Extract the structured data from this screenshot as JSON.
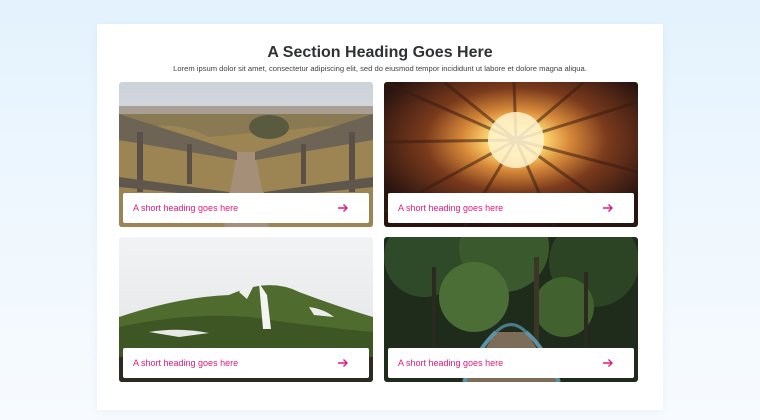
{
  "section": {
    "heading": "A Section Heading Goes Here",
    "subheading": "Lorem ipsum dolor sit amet, consectetur adipiscing elit, sed do eiusmod tempor incididunt ut labore et dolore magna aliqua."
  },
  "cards": [
    {
      "title": "A short heading goes here",
      "icon": "arrow-right-icon",
      "image": "wooden-boardwalk-photo"
    },
    {
      "title": "A short heading goes here",
      "icon": "arrow-right-icon",
      "image": "courtyard-looking-up-photo"
    },
    {
      "title": "A short heading goes here",
      "icon": "arrow-right-icon",
      "image": "snowy-green-hill-photo"
    },
    {
      "title": "A short heading goes here",
      "icon": "arrow-right-icon",
      "image": "forest-bridge-photo"
    }
  ],
  "colors": {
    "accent": "#e2197c",
    "heading": "#2f3133",
    "body_text": "#3f4246",
    "background_top": "#e3f2fd"
  }
}
